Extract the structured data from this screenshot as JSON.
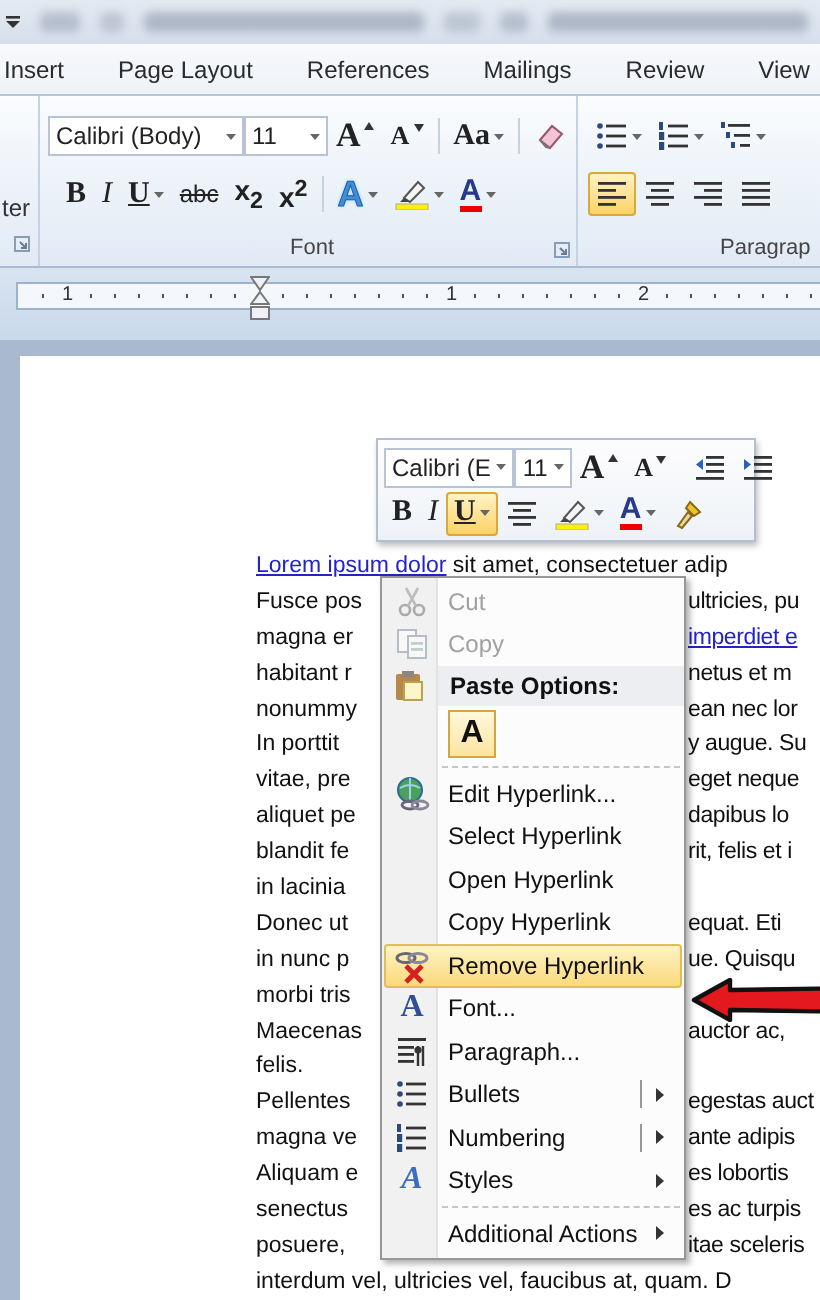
{
  "ribbon_tabs": [
    {
      "label": "Insert",
      "selected": false
    },
    {
      "label": "Page Layout",
      "selected": false
    },
    {
      "label": "References",
      "selected": false
    },
    {
      "label": "Mailings",
      "selected": false
    },
    {
      "label": "Review",
      "selected": false
    },
    {
      "label": "View",
      "selected": false
    }
  ],
  "ribbon": {
    "clipboard_group": {
      "button_label": "ter"
    },
    "font_group": {
      "label": "Font",
      "font_name": "Calibri (Body)",
      "font_size": "11",
      "row_1": [
        {
          "kind": "grow-font",
          "text": "A"
        },
        {
          "kind": "shrink-font",
          "text": "A"
        },
        {
          "kind": "change-case",
          "text": "Aa"
        },
        {
          "kind": "clear-format"
        }
      ],
      "row_2": [
        {
          "kind": "bold",
          "text": "B",
          "selected": false
        },
        {
          "kind": "italic",
          "text": "I",
          "selected": false
        },
        {
          "kind": "underline",
          "text": "U",
          "selected": false
        },
        {
          "kind": "strike",
          "text": "abc",
          "selected": false
        },
        {
          "kind": "subscript",
          "text": "x$_{2}$",
          "selected": false
        },
        {
          "kind": "superscript",
          "text": "x$^{2}$",
          "selected": false
        },
        {
          "kind": "text-effects",
          "text": "A"
        },
        {
          "kind": "highlight"
        },
        {
          "kind": "font-color",
          "text": "A"
        }
      ]
    },
    "paragraph_group": {
      "label": "Paragrap",
      "row_1": [
        {
          "kind": "bullets"
        },
        {
          "kind": "numbering"
        },
        {
          "kind": "multilevel"
        }
      ],
      "row_2": [
        {
          "kind": "align-left",
          "selected": true
        },
        {
          "kind": "align-center",
          "selected": false
        },
        {
          "kind": "align-right",
          "selected": false
        },
        {
          "kind": "justify",
          "selected": false
        }
      ]
    }
  },
  "ruler": {
    "labels": [
      "1",
      "1",
      "2"
    ]
  },
  "mini_toolbar": {
    "font_name": "Calibri (E",
    "font_size": "11",
    "row_1": [
      {
        "kind": "grow-font",
        "text": "A"
      },
      {
        "kind": "shrink-font",
        "text": "A"
      },
      {
        "kind": "indent-decrease"
      },
      {
        "kind": "indent-increase"
      }
    ],
    "row_2": [
      {
        "kind": "bold",
        "text": "B",
        "selected": false
      },
      {
        "kind": "italic",
        "text": "I",
        "selected": false
      },
      {
        "kind": "underline",
        "text": "U",
        "selected": true
      },
      {
        "kind": "align-center",
        "selected": false
      },
      {
        "kind": "highlight"
      },
      {
        "kind": "font-color",
        "text": "A"
      },
      {
        "kind": "format-painter"
      }
    ]
  },
  "document": {
    "lines": [
      {
        "left": [
          {
            "text": "Lorem ipsum dolor",
            "link": true
          },
          {
            "text": " sit amet, consectetuer adip",
            "link": false
          }
        ]
      },
      {
        "left": [
          {
            "text": "Fusce pos",
            "link": false
          }
        ],
        "right": [
          {
            "text": "ultricies, pu",
            "link": false
          }
        ]
      },
      {
        "left": [
          {
            "text": "magna er",
            "link": false
          }
        ],
        "right": [
          {
            "text": "imperdiet e",
            "link": true
          }
        ]
      },
      {
        "left": [
          {
            "text": "habitant r",
            "link": false
          }
        ],
        "right": [
          {
            "text": "netus et m",
            "link": false
          }
        ]
      },
      {
        "left": [
          {
            "text": "nonummy",
            "link": false
          }
        ],
        "right": [
          {
            "text": "ean nec lor",
            "link": false
          }
        ]
      },
      {
        "left": [
          {
            "text": "In porttit",
            "link": false
          }
        ],
        "right": [
          {
            "text": "y augue. Su",
            "link": false
          }
        ]
      },
      {
        "left": [
          {
            "text": "vitae, pre",
            "link": false
          }
        ],
        "right": [
          {
            "text": "eget neque",
            "link": false
          }
        ]
      },
      {
        "left": [
          {
            "text": "aliquet pe",
            "link": false
          }
        ],
        "right": [
          {
            "text": "dapibus lo",
            "link": false
          }
        ]
      },
      {
        "left": [
          {
            "text": "blandit fe",
            "link": false
          }
        ],
        "right": [
          {
            "text": "rit, felis et i",
            "link": false
          }
        ]
      },
      {
        "left": [
          {
            "text": "in lacinia",
            "link": false
          }
        ]
      },
      {
        "left": [
          {
            "text": "Donec ut",
            "link": false
          }
        ],
        "right": [
          {
            "text": "equat. Eti",
            "link": false
          }
        ]
      },
      {
        "left": [
          {
            "text": "in nunc p",
            "link": false
          }
        ],
        "right": [
          {
            "text": "ue. Quisqu",
            "link": false
          }
        ]
      },
      {
        "left": [
          {
            "text": "morbi tris",
            "link": false
          }
        ]
      },
      {
        "left": [
          {
            "text": "Maecenas",
            "link": false
          }
        ],
        "right": [
          {
            "text": "auctor ac,",
            "link": false
          }
        ]
      },
      {
        "left": [
          {
            "text": "felis.",
            "link": false
          }
        ]
      },
      {
        "left": [
          {
            "text": "Pellentes",
            "link": false
          }
        ],
        "right": [
          {
            "text": "egestas auct",
            "link": false
          }
        ]
      },
      {
        "left": [
          {
            "text": "magna ve",
            "link": false
          }
        ],
        "right": [
          {
            "text": "ante adipis",
            "link": false
          }
        ]
      },
      {
        "left": [
          {
            "text": "Aliquam e",
            "link": false
          }
        ],
        "right": [
          {
            "text": "es lobortis",
            "link": false
          }
        ]
      },
      {
        "left": [
          {
            "text": "senectus",
            "link": false
          }
        ],
        "right": [
          {
            "text": "es ac turpis",
            "link": false
          }
        ]
      },
      {
        "left": [
          {
            "text": "posuere,",
            "link": false
          }
        ],
        "right": [
          {
            "text": "itae sceleris",
            "link": false
          }
        ]
      },
      {
        "left": [
          {
            "text": "interdum vel, ultricies vel, faucibus at, quam. D",
            "link": false
          }
        ]
      }
    ]
  },
  "context_menu": {
    "items": [
      {
        "kind": "cut",
        "label": "Cut",
        "disabled": true,
        "selected": false,
        "submenu": false
      },
      {
        "kind": "copy",
        "label": "Copy",
        "disabled": true,
        "selected": false,
        "submenu": false
      },
      {
        "kind": "heading",
        "label": "Paste Options:"
      },
      {
        "kind": "paste",
        "label": "A"
      },
      {
        "kind": "separator"
      },
      {
        "kind": "edit-link",
        "label": "Edit Hyperlink...",
        "disabled": false,
        "selected": false,
        "submenu": false
      },
      {
        "kind": "plain",
        "label": "Select Hyperlink",
        "disabled": false,
        "selected": false,
        "submenu": false
      },
      {
        "kind": "plain",
        "label": "Open Hyperlink",
        "disabled": false,
        "selected": false,
        "submenu": false
      },
      {
        "kind": "plain",
        "label": "Copy Hyperlink",
        "disabled": false,
        "selected": false,
        "submenu": false
      },
      {
        "kind": "remove-link",
        "label": "Remove Hyperlink",
        "disabled": false,
        "selected": true,
        "submenu": false
      },
      {
        "kind": "font",
        "icon_text": "A",
        "label": "Font...",
        "disabled": false,
        "selected": false,
        "submenu": false
      },
      {
        "kind": "paragraph",
        "label": "Paragraph...",
        "disabled": false,
        "selected": false,
        "submenu": false
      },
      {
        "kind": "bullets",
        "label": "Bullets",
        "disabled": false,
        "selected": false,
        "submenu": true,
        "split": true
      },
      {
        "kind": "numbering",
        "label": "Numbering",
        "disabled": false,
        "selected": false,
        "submenu": true,
        "split": true
      },
      {
        "kind": "styles",
        "icon_text": "A",
        "label": "Styles",
        "disabled": false,
        "selected": false,
        "submenu": true
      },
      {
        "kind": "separator"
      },
      {
        "kind": "plain",
        "label": "Additional Actions",
        "disabled": false,
        "selected": false,
        "submenu": true
      }
    ]
  }
}
